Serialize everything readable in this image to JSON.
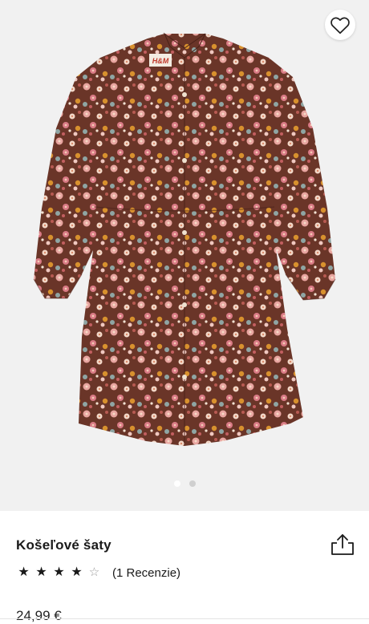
{
  "gallery": {
    "current_slide": 1,
    "total_slides": 2,
    "favorite_icon": "heart-outline-icon"
  },
  "product": {
    "name": "Košeľové šaty",
    "rating_value": 4,
    "rating_max": 5,
    "reviews_label": "(1 Recenzie)",
    "price": "24,99 €",
    "brand_tag": "H&M",
    "share_icon": "share-icon"
  },
  "colors": {
    "dress_base": "#6a3528",
    "gallery_bg": "#f1f1f1",
    "text": "#1a1a1a"
  }
}
